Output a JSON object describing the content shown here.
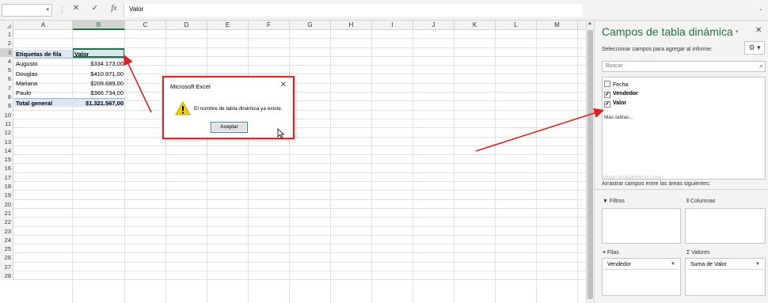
{
  "formula_bar": {
    "name_box": "",
    "cancel_icon": "✕",
    "enter_icon": "✓",
    "fx_label": "fx",
    "formula": "Valor"
  },
  "sheet": {
    "columns": [
      "A",
      "B",
      "C",
      "D",
      "E",
      "F",
      "G",
      "H",
      "I",
      "J",
      "K",
      "L",
      "M"
    ],
    "rows": [
      "1",
      "2",
      "3",
      "4",
      "5",
      "6",
      "7",
      "8",
      "9",
      "10",
      "11",
      "12",
      "13",
      "14",
      "15",
      "16",
      "17",
      "18",
      "19",
      "20",
      "21",
      "22",
      "23",
      "24",
      "25",
      "26",
      "27",
      "28"
    ],
    "pivot": {
      "header_label": "Etiquetas de fila",
      "header_value": "Valor",
      "items": [
        {
          "label": "Augusto",
          "value": "$334.173,00"
        },
        {
          "label": "Douglas",
          "value": "$410.971,00"
        },
        {
          "label": "Mariana",
          "value": "$209.689,00"
        },
        {
          "label": "Paulo",
          "value": "$366.734,00"
        }
      ],
      "total_label": "Total general",
      "total_value": "$1.321.567,00"
    }
  },
  "dialog": {
    "title": "Microsoft Excel",
    "close": "✕",
    "message": "El nombre de tabla dinámica ya existe.",
    "ok_label": "Aceptar"
  },
  "pane": {
    "title": "Campos de tabla dinámica",
    "subtitle": "Seleccionar campos para agregar al informe:",
    "search_placeholder": "Buscar",
    "fields": [
      {
        "name": "Fecha",
        "checked": false
      },
      {
        "name": "Vendedor",
        "checked": true
      },
      {
        "name": "Valor",
        "checked": true
      }
    ],
    "more_tables": "Más tablas...",
    "watermark": "www.ninjadelexcel.com",
    "drag_label": "Arrastrar campos entre las áreas siguientes:",
    "areas": {
      "filters": "Filtros",
      "columns": "Columnas",
      "rows": "Filas",
      "values": "Valores",
      "rows_item": "Vendedor",
      "values_item": "Suma de Valor"
    }
  },
  "colors": {
    "accent": "#217346",
    "annotation": "#e02020",
    "pivot_header": "#dce6f1"
  }
}
